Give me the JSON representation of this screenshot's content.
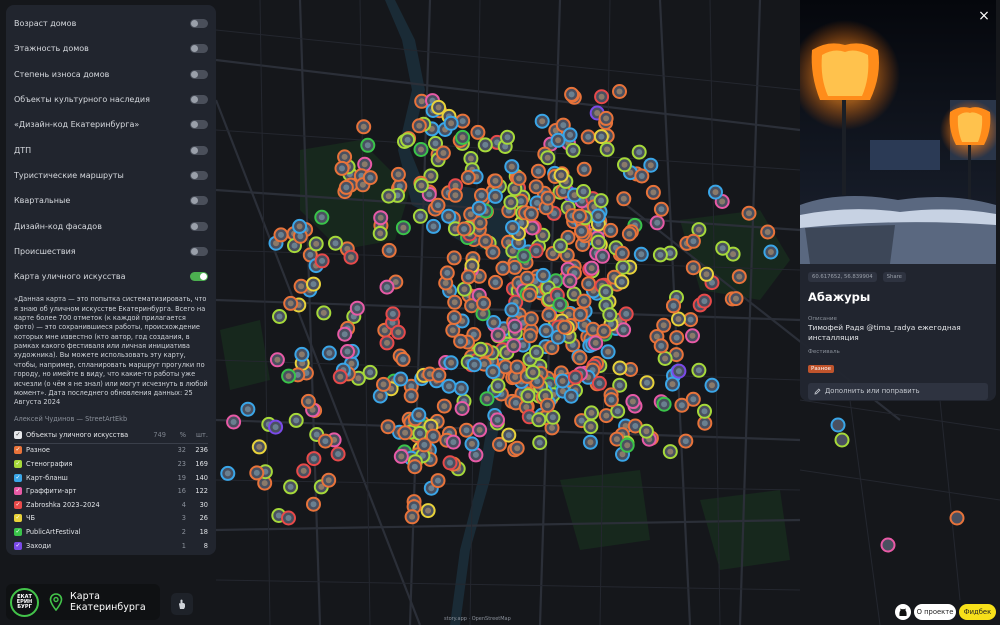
{
  "layers": [
    {
      "label": "Возраст домов",
      "on": false
    },
    {
      "label": "Этажность домов",
      "on": false
    },
    {
      "label": "Степень износа домов",
      "on": false
    },
    {
      "label": "Объекты культурного наследия",
      "on": false
    },
    {
      "label": "«Дизайн-код Екатеринбурга»",
      "on": false
    },
    {
      "label": "ДТП",
      "on": false
    },
    {
      "label": "Туристические маршруты",
      "on": false
    },
    {
      "label": "Квартальные",
      "on": false
    },
    {
      "label": "Дизайн-код фасадов",
      "on": false
    },
    {
      "label": "Происшествия",
      "on": false
    },
    {
      "label": "Карта уличного искусства",
      "on": true
    }
  ],
  "description": "«Данная карта — это попытка систематизировать, что я знаю об уличном искусстве Екатеринбурга. Всего на карте более 700 отметок (к каждой прилагается фото) — это сохранившиеся работы, происхождение которых мне известно (кто автор, год создания, в рамках какого фестиваля или личная инициатива художника). Вы можете использовать эту карту, чтобы, например, спланировать маршрут прогулки по городу, но имейте в виду, что какие-то работы уже исчезли (о чём я не знал) или могут исчезнуть в любой момент». Дата последнего обновления данных: 25 Августа 2024",
  "author": "Алексей Чудинов — StreetArtEkb",
  "categories_header": {
    "name": "Объекты уличного искусства",
    "count": "749",
    "pct_label": "%",
    "num_label": "шт."
  },
  "categories": [
    {
      "name": "Разное",
      "pct": "32",
      "num": "236",
      "color": "#e8733a"
    },
    {
      "name": "Стенография",
      "pct": "23",
      "num": "169",
      "color": "#a6d93a"
    },
    {
      "name": "Карт-бланш",
      "pct": "19",
      "num": "140",
      "color": "#3aa6e8"
    },
    {
      "name": "Граффити-арт",
      "pct": "16",
      "num": "122",
      "color": "#e85aa6"
    },
    {
      "name": "Zabroshka 2023–2024",
      "pct": "4",
      "num": "30",
      "color": "#e84a4a"
    },
    {
      "name": "ЧБ",
      "pct": "3",
      "num": "26",
      "color": "#e8d23a"
    },
    {
      "name": "PublicArtFestival",
      "pct": "2",
      "num": "18",
      "color": "#3ac44a"
    },
    {
      "name": "Заходи",
      "pct": "1",
      "num": "8",
      "color": "#7a4ae8"
    }
  ],
  "logo": {
    "badge": "ЕКАТ ЕРИН БУРГ",
    "title_line1": "Карта",
    "title_line2": "Екатеринбурга"
  },
  "attribution": "story.app · OpenStreetMap",
  "detail": {
    "coords": "60.617652, 56.839904",
    "share": "Share",
    "title": "Абажуры",
    "desc_label": "Описание",
    "desc_text": "Тимофей Радя @tima_radya ежегодная инсталляция",
    "festival_label": "Фестиваль",
    "festival_tag": "Разное",
    "edit": "Дополнить или поправить"
  },
  "close_icon": "×",
  "about": "О проекте",
  "feedback": "Фидбек"
}
